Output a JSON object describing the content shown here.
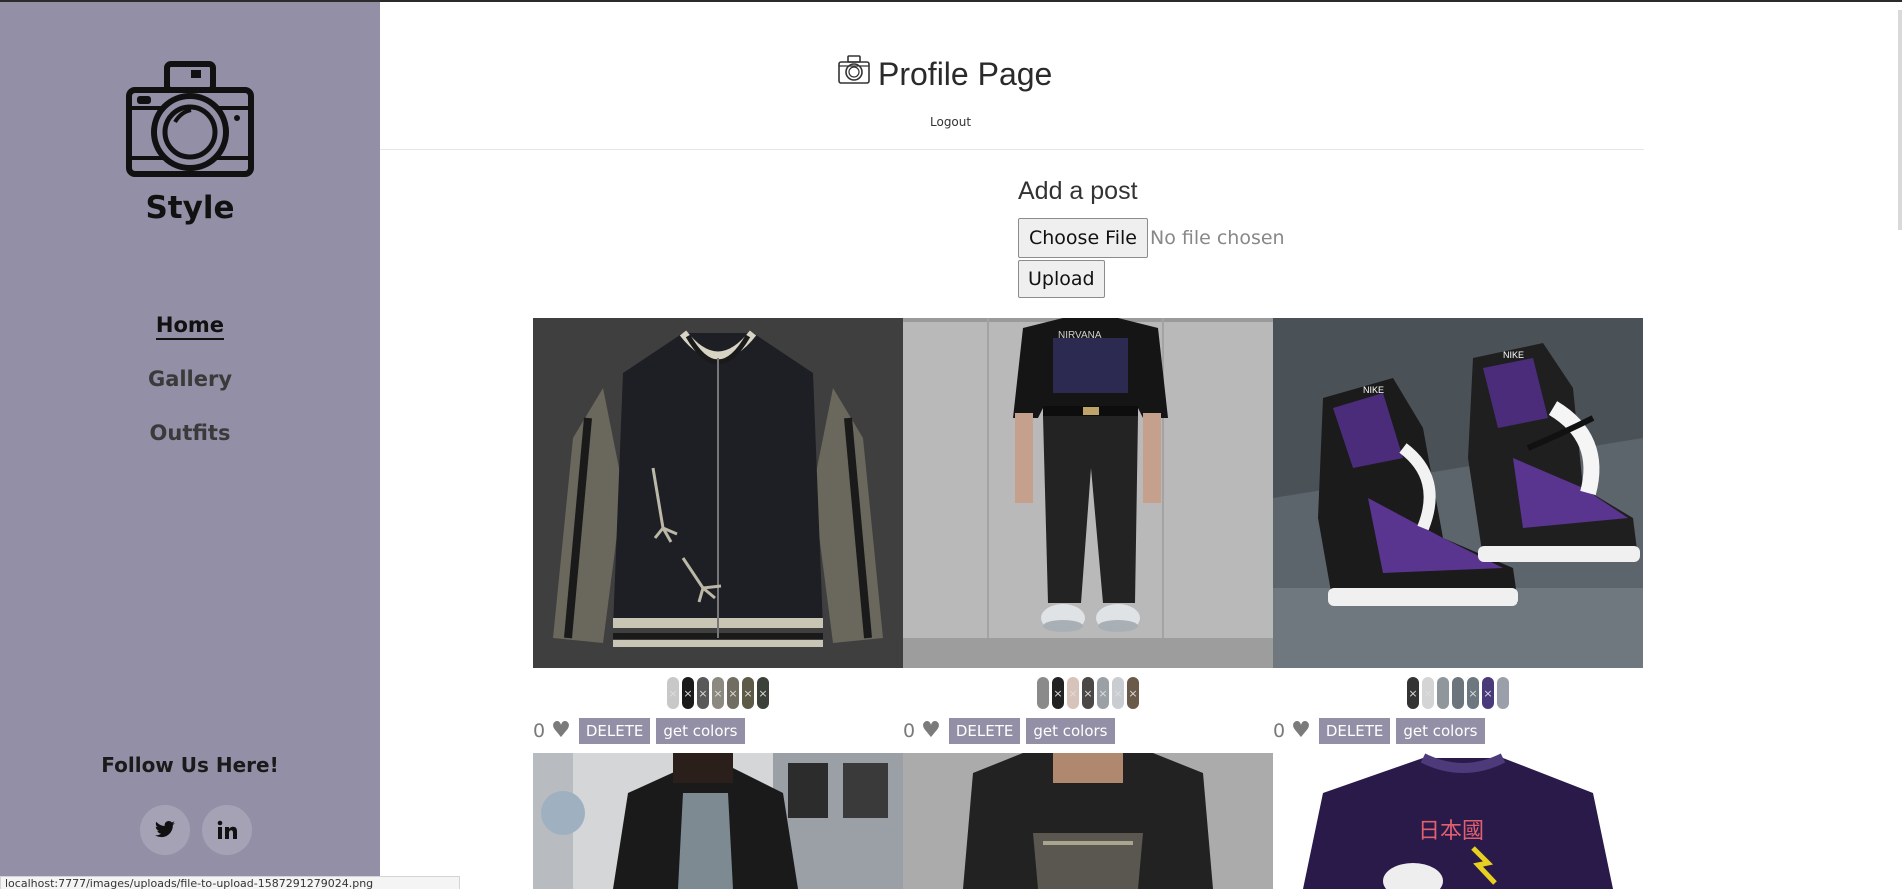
{
  "brand": {
    "name": "Style",
    "logo_icon": "camera-icon"
  },
  "nav": {
    "items": [
      {
        "label": "Home",
        "active": true
      },
      {
        "label": "Gallery",
        "active": false
      },
      {
        "label": "Outfits",
        "active": false
      }
    ]
  },
  "follow": {
    "label": "Follow Us Here!",
    "icons": [
      "twitter-icon",
      "linkedin-icon"
    ]
  },
  "header": {
    "title": "Profile Page",
    "title_icon": "camera-icon",
    "logout_label": "Logout"
  },
  "add_post": {
    "title": "Add a post",
    "choose_file_label": "Choose File",
    "file_status": "No file chosen",
    "upload_label": "Upload"
  },
  "posts": [
    {
      "likes": "0",
      "delete_label": "DELETE",
      "colors_label": "get colors",
      "swatches": [
        "#c8c8c8",
        "#1a1a1a",
        "#595959",
        "#8c8a80",
        "#716d60",
        "#5e5a48",
        "#3b4138"
      ],
      "image_desc": "jacket"
    },
    {
      "likes": "0",
      "delete_label": "DELETE",
      "colors_label": "get colors",
      "swatches": [
        "#8a8a8a",
        "#222222",
        "#d8c3ba",
        "#4b4747",
        "#9aa0a6",
        "#c9cdd2",
        "#6a5a4a"
      ],
      "image_desc": "outfit"
    },
    {
      "likes": "0",
      "delete_label": "DELETE",
      "colors_label": "get colors",
      "swatches": [
        "#333333",
        "#d4d4d4",
        "#8f969c",
        "#6c757c",
        "#6d7780",
        "#4a3a7a",
        "#9a9faa"
      ],
      "image_desc": "sneakers"
    }
  ],
  "status_bar": {
    "url": "localhost:7777/images/uploads/file-to-upload-1587291279024.png"
  }
}
